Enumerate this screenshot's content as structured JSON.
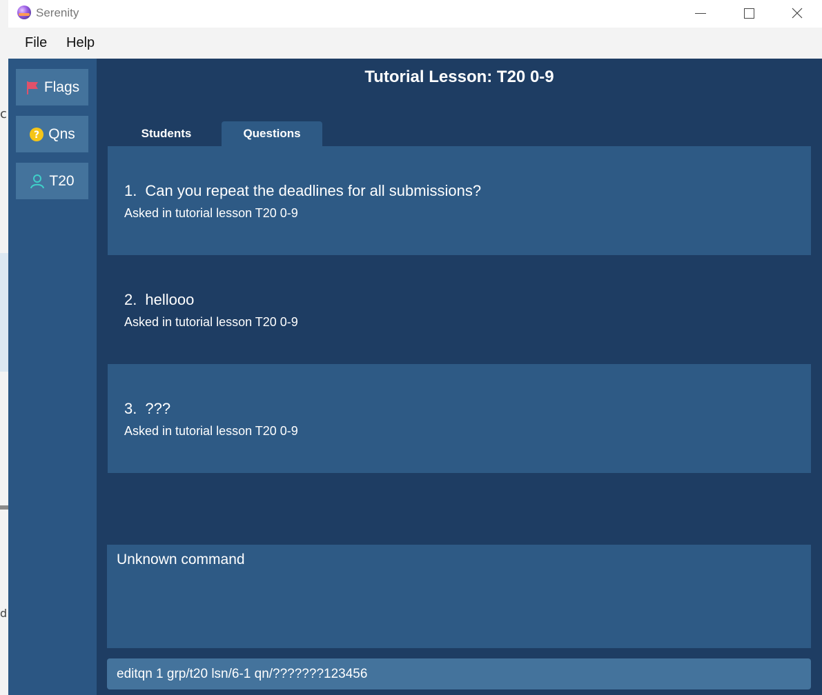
{
  "window": {
    "title": "Serenity"
  },
  "menu": [
    "File",
    "Help"
  ],
  "sidebar": {
    "items": [
      {
        "label": "Flags",
        "icon": "flag-icon"
      },
      {
        "label": "Qns",
        "icon": "question-icon"
      },
      {
        "label": "T20",
        "icon": "person-icon"
      }
    ]
  },
  "main": {
    "title": "Tutorial Lesson: T20 0-9",
    "tabs": [
      {
        "label": "Students",
        "active": false
      },
      {
        "label": "Questions",
        "active": true
      }
    ],
    "questions": [
      {
        "num": "1.",
        "text": "Can you repeat the deadlines for all submissions?",
        "sub": "Asked in tutorial lesson T20 0-9"
      },
      {
        "num": "2.",
        "text": "hellooo",
        "sub": "Asked in tutorial lesson T20 0-9"
      },
      {
        "num": "3.",
        "text": "???",
        "sub": "Asked in tutorial lesson T20 0-9"
      }
    ]
  },
  "result": {
    "text": "Unknown command"
  },
  "command": {
    "value": "editqn 1 grp/t20 lsn/6-1 qn/???????123456"
  },
  "colors": {
    "main_bg": "#1e3d63",
    "card_bg": "#2e5a85",
    "button_bg": "#44739c",
    "sidebar_bg": "#2b5683"
  }
}
